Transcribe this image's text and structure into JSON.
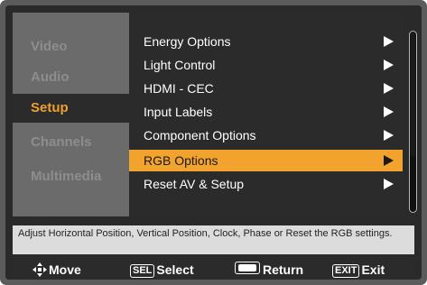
{
  "sidebar": {
    "items": [
      {
        "label": "Video",
        "active": false
      },
      {
        "label": "Audio",
        "active": false
      },
      {
        "label": "Setup",
        "active": true
      },
      {
        "label": "Channels",
        "active": false
      },
      {
        "label": "Multimedia",
        "active": false
      }
    ]
  },
  "menu": {
    "items": [
      {
        "label": "Energy Options",
        "selected": false
      },
      {
        "label": "Light Control",
        "selected": false
      },
      {
        "label": "HDMI - CEC",
        "selected": false
      },
      {
        "label": "Input Labels",
        "selected": false
      },
      {
        "label": "Component Options",
        "selected": false
      },
      {
        "label": "RGB Options",
        "selected": true
      },
      {
        "label": "Reset AV & Setup",
        "selected": false
      }
    ]
  },
  "help": {
    "text": "Adjust Horizontal Position, Vertical Position, Clock, Phase or Reset the RGB settings."
  },
  "footer": {
    "move_label": "Move",
    "select_key": "SEL",
    "select_label": "Select",
    "return_label": "Return",
    "exit_key": "EXIT",
    "exit_label": "Exit"
  },
  "colors": {
    "accent": "#f2a32e",
    "active_tab_text": "#f0a030",
    "panel_bg": "#2b2b2b",
    "sidebar_bg": "#6b6b6b"
  }
}
